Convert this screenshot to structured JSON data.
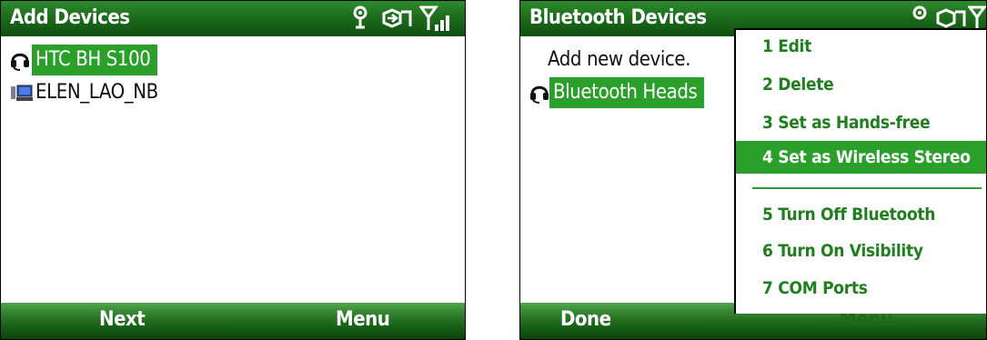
{
  "left": {
    "title": "Add Devices",
    "devices": [
      {
        "name": "HTC BH S100",
        "icon": "headset-icon",
        "selected": true
      },
      {
        "name": "ELEN_LAO_NB",
        "icon": "computer-icon",
        "selected": false
      }
    ],
    "softkeys": {
      "left": "Next",
      "right": "Menu"
    }
  },
  "right": {
    "title": "Bluetooth Devices",
    "list": [
      {
        "name": "Add new device.",
        "icon": "",
        "selected": false
      },
      {
        "name": "Bluetooth Heads",
        "icon": "headset-icon",
        "selected": true
      }
    ],
    "menu": [
      "1 Edit",
      "2 Delete",
      "3 Set as Hands-free",
      "4 Set as Wireless Stereo",
      "5 Turn Off Bluetooth",
      "6 Turn On Visibility",
      "7 COM Ports"
    ],
    "menu_highlighted_index": 3,
    "softkeys": {
      "left": "Done",
      "right": "Menu"
    }
  },
  "colors": {
    "title_bar": "#1d6d1c",
    "selection": "#2aa02a",
    "menu_text": "#1f7f1f"
  }
}
